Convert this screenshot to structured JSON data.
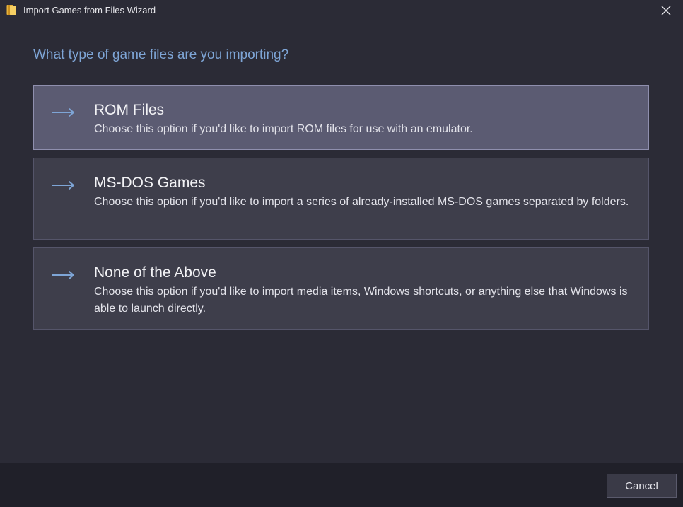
{
  "window": {
    "title": "Import Games from Files Wizard",
    "app_icon": "folder-icon",
    "close_icon": "close-icon"
  },
  "question": "What type of game files are you importing?",
  "options": [
    {
      "title": "ROM Files",
      "description": "Choose this option if you'd like to import ROM files for use with an emulator.",
      "icon": "arrow-right-icon",
      "selected": true
    },
    {
      "title": "MS-DOS Games",
      "description": "Choose this option if you'd like to import a series of already-installed MS-DOS games separated by folders.",
      "icon": "arrow-right-icon",
      "selected": false
    },
    {
      "title": "None of the Above",
      "description": "Choose this option if you'd like to import media items, Windows shortcuts, or anything else that Windows is able to launch directly.",
      "icon": "arrow-right-icon",
      "selected": false
    }
  ],
  "footer": {
    "cancel_label": "Cancel"
  },
  "colors": {
    "background": "#2b2b36",
    "accent": "#7ea5d6",
    "option_bg": "#3e3e4b",
    "option_selected_bg": "#5b5b72",
    "footer_bg": "#202029"
  }
}
